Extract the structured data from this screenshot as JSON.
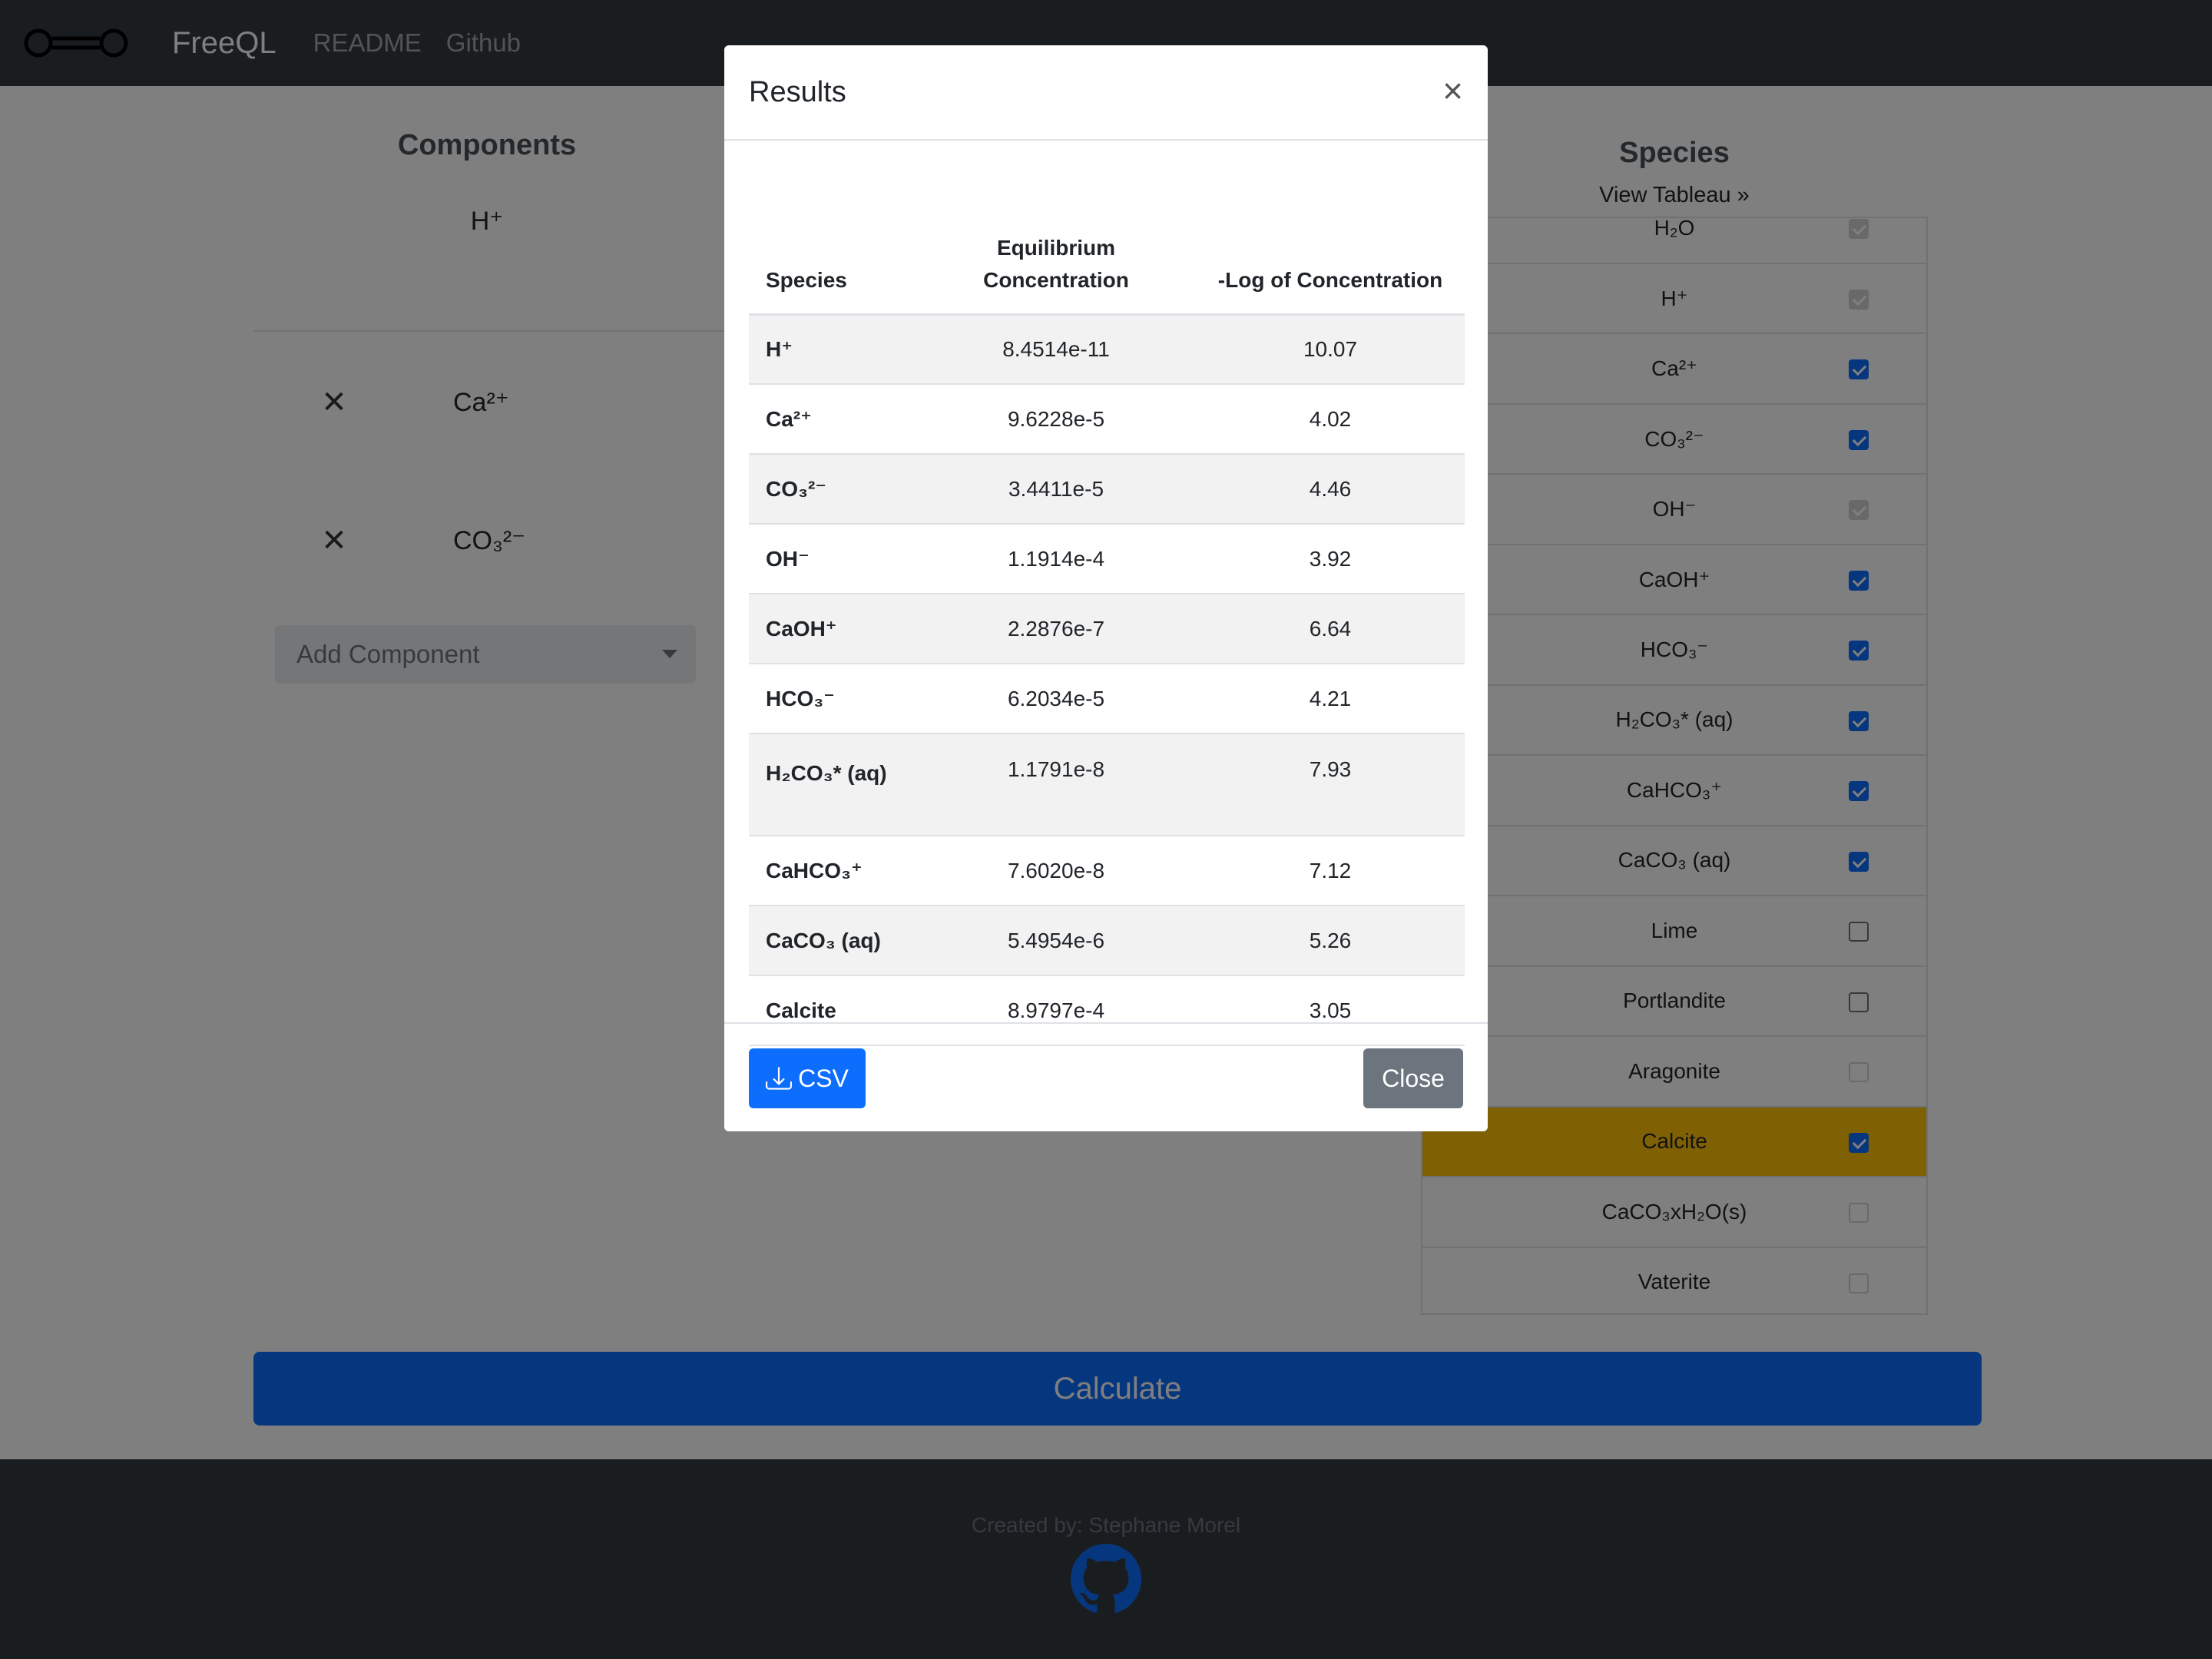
{
  "navbar": {
    "brand": "FreeQL",
    "links": [
      "README",
      "Github"
    ],
    "logo_icon": "molecule-icon"
  },
  "components": {
    "heading": "Components",
    "fixed": "H⁺",
    "items": [
      {
        "remove": "✕",
        "name": "Ca²⁺"
      },
      {
        "remove": "✕",
        "name": "CO₃²⁻"
      }
    ],
    "add_placeholder": "Add Component"
  },
  "species": {
    "heading": "Species",
    "view_tableau": "View Tableau »",
    "items": [
      {
        "name": "H₂O",
        "checked": true,
        "disabled": true
      },
      {
        "name": "H⁺",
        "checked": true,
        "disabled": true
      },
      {
        "name": "Ca²⁺",
        "checked": true,
        "disabled": false
      },
      {
        "name": "CO₃²⁻",
        "checked": true,
        "disabled": false
      },
      {
        "name": "OH⁻",
        "checked": true,
        "disabled": true
      },
      {
        "name": "CaOH⁺",
        "checked": true,
        "disabled": false
      },
      {
        "name": "HCO₃⁻",
        "checked": true,
        "disabled": false
      },
      {
        "name": "H₂CO₃* (aq)",
        "checked": true,
        "disabled": false
      },
      {
        "name": "CaHCO₃⁺",
        "checked": true,
        "disabled": false
      },
      {
        "name": "CaCO₃ (aq)",
        "checked": true,
        "disabled": false
      },
      {
        "name": "Lime",
        "checked": false,
        "disabled": false
      },
      {
        "name": "Portlandite",
        "checked": false,
        "disabled": false
      },
      {
        "name": "Aragonite",
        "checked": false,
        "disabled": true
      },
      {
        "name": "Calcite",
        "checked": true,
        "disabled": false,
        "highlight": true
      },
      {
        "name": "CaCO₃xH₂O(s)",
        "checked": false,
        "disabled": true
      },
      {
        "name": "Vaterite",
        "checked": false,
        "disabled": true
      }
    ]
  },
  "calculate_label": "Calculate",
  "footer": {
    "credit": "Created by: Stephane Morel",
    "icon": "github-icon"
  },
  "modal": {
    "title": "Results",
    "close_x": "×",
    "columns": [
      "Species",
      "Equilibrium Concentration",
      "-Log of Concentration"
    ],
    "rows": [
      {
        "species": "H⁺",
        "conc": "8.4514e-11",
        "log": "10.07"
      },
      {
        "species": "Ca²⁺",
        "conc": "9.6228e-5",
        "log": "4.02"
      },
      {
        "species": "CO₃²⁻",
        "conc": "3.4411e-5",
        "log": "4.46"
      },
      {
        "species": "OH⁻",
        "conc": "1.1914e-4",
        "log": "3.92"
      },
      {
        "species": "CaOH⁺",
        "conc": "2.2876e-7",
        "log": "6.64"
      },
      {
        "species": "HCO₃⁻",
        "conc": "6.2034e-5",
        "log": "4.21"
      },
      {
        "species": "H₂CO₃* (aq)",
        "conc": "1.1791e-8",
        "log": "7.93"
      },
      {
        "species": "CaHCO₃⁺",
        "conc": "7.6020e-8",
        "log": "7.12"
      },
      {
        "species": "CaCO₃ (aq)",
        "conc": "5.4954e-6",
        "log": "5.26"
      },
      {
        "species": "Calcite",
        "conc": "8.9797e-4",
        "log": "3.05"
      }
    ],
    "csv_label": "CSV",
    "close_label": "Close"
  },
  "colors": {
    "navbar": "#343a40",
    "primary": "#0d6efd",
    "secondary": "#6c757d",
    "highlight": "#ffc107"
  }
}
